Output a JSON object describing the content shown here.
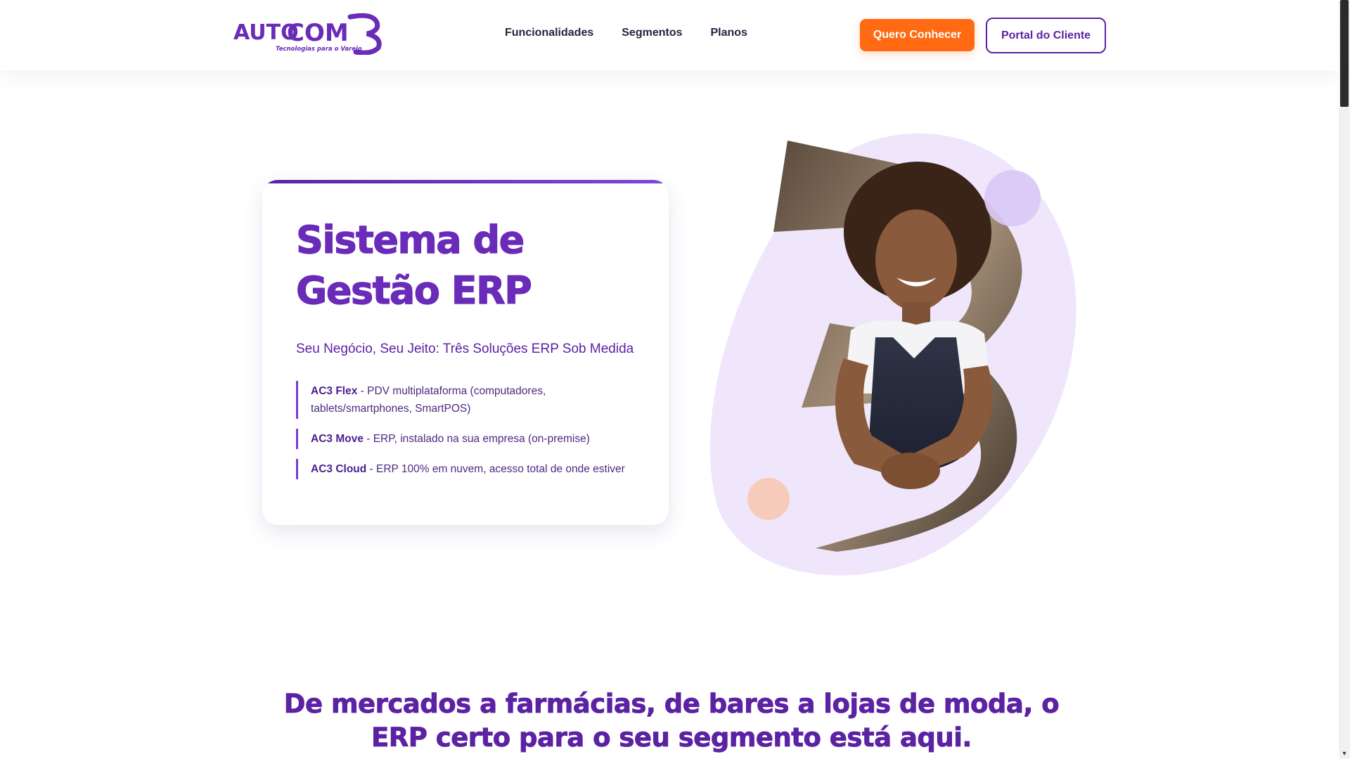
{
  "header": {
    "logo": {
      "brand_left": "AUTO",
      "brand_right": "COM",
      "brand_mark": "3",
      "tagline": "Tecnologias para o Varejo"
    },
    "nav": [
      {
        "label": "Funcionalidades"
      },
      {
        "label": "Segmentos"
      },
      {
        "label": "Planos"
      }
    ],
    "cta_primary": "Quero Conhecer",
    "cta_secondary": "Portal do Cliente"
  },
  "hero": {
    "title": "Sistema de Gestão ERP",
    "subtitle": "Seu Negócio, Seu Jeito: Três Soluções ERP Sob Medida",
    "products": [
      {
        "name": "AC3 Flex",
        "desc": " - PDV multiplataforma (computadores, tablets/smartphones, SmartPOS)"
      },
      {
        "name": "AC3 Move",
        "desc": " - ERP, instalado na sua empresa (on-premise)"
      },
      {
        "name": "AC3 Cloud",
        "desc": " - ERP 100% em nuvem, acesso total de onde estiver"
      }
    ]
  },
  "segments": {
    "heading": "De mercados a farmácias, de bares a lojas de moda, o ERP certo para o seu segmento está aqui."
  },
  "colors": {
    "brand_purple": "#5b22a3",
    "accent_orange": "#ff6a13",
    "blob_lavender": "#efe6fb"
  },
  "icons": {
    "hero_image": "woman-shopkeeper-photo",
    "decor_circle_purple": "decor-circle-purple",
    "decor_circle_peach": "decor-circle-peach"
  }
}
